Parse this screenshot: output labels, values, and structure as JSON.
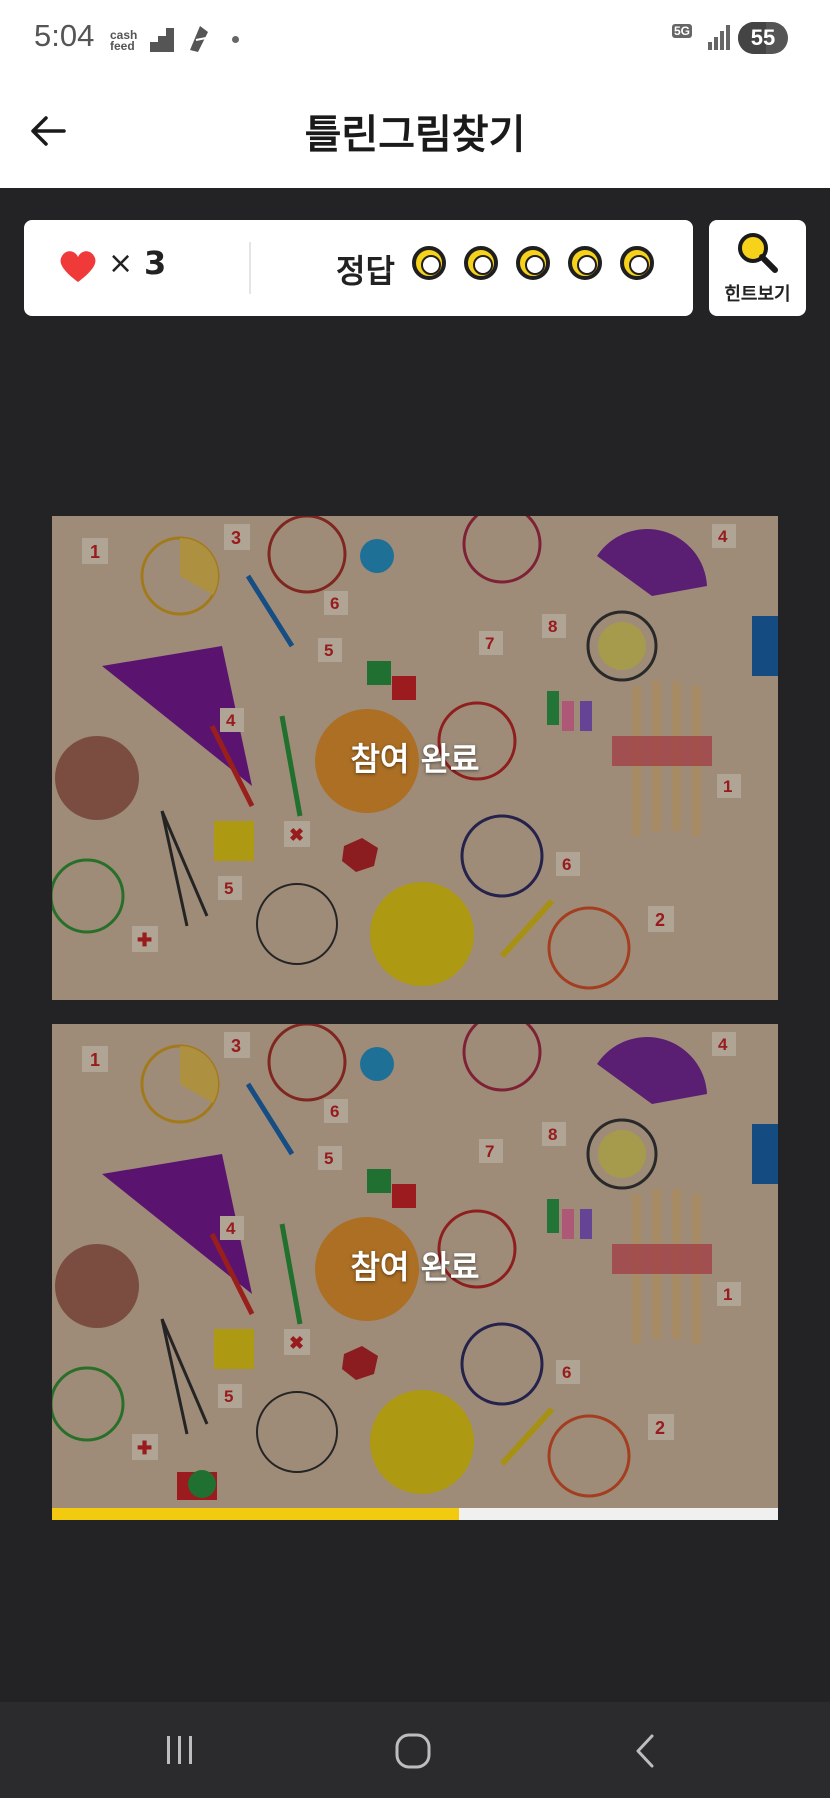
{
  "status_bar": {
    "time": "5:04",
    "app_badge": "cash\nfeed",
    "network": "5G",
    "battery": "55",
    "battery_level": 0.55
  },
  "header": {
    "title": "틀린그림찾기",
    "back_icon": "arrow-left-icon"
  },
  "game": {
    "lives_symbol": "×",
    "lives_count": "3",
    "answer_label": "정답",
    "answer_slots": 5,
    "answers_found": 0,
    "hint_label": "힌트보기",
    "heart_color": "#f03a3a",
    "slot_color": "#f6d21a"
  },
  "images": [
    {
      "overlay_text": "참여 완료"
    },
    {
      "overlay_text": "참여 완료"
    }
  ],
  "progress": {
    "fraction": 0.56,
    "color": "#f2cb10"
  },
  "nav": {
    "recent_icon": "recent-apps-icon",
    "home_icon": "home-icon",
    "back_icon": "back-icon"
  }
}
